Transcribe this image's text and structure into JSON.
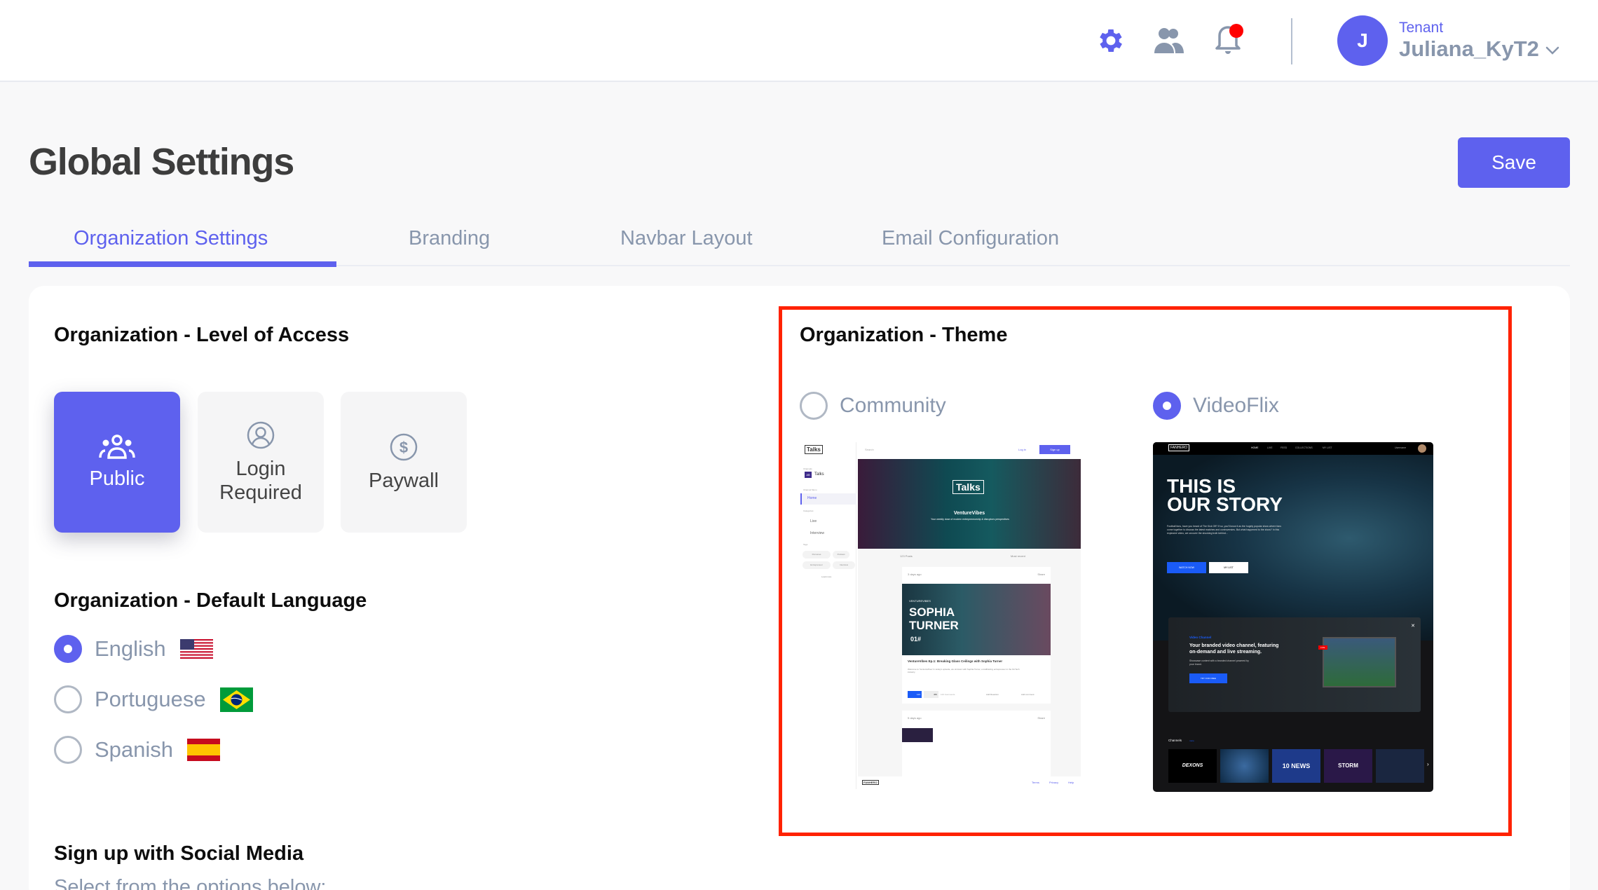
{
  "header": {
    "icons": [
      "gear-icon",
      "users-icon",
      "bell-icon"
    ],
    "notification_dot_color": "#ff0000",
    "avatar_initial": "J",
    "tenant_label": "Tenant",
    "tenant_name": "Juliana_KyT2"
  },
  "page": {
    "title": "Global Settings",
    "save_label": "Save"
  },
  "tabs": [
    {
      "label": "Organization Settings",
      "active": true
    },
    {
      "label": "Branding",
      "active": false
    },
    {
      "label": "Navbar Layout",
      "active": false
    },
    {
      "label": "Email Configuration",
      "active": false
    }
  ],
  "access": {
    "title": "Organization - Level of Access",
    "options": [
      {
        "label": "Public",
        "icon": "group-icon",
        "selected": true
      },
      {
        "label": "Login\nRequired",
        "icon": "user-circle-icon",
        "selected": false
      },
      {
        "label": "Paywall",
        "icon": "dollar-circle-icon",
        "selected": false
      }
    ]
  },
  "language": {
    "title": "Organization - Default Language",
    "options": [
      {
        "label": "English",
        "flag": "us-flag",
        "selected": true
      },
      {
        "label": "Portuguese",
        "flag": "brazil-flag",
        "selected": false
      },
      {
        "label": "Spanish",
        "flag": "spain-flag",
        "selected": false
      }
    ]
  },
  "social": {
    "title": "Sign up with Social Media",
    "subtitle": "Select from the options below:"
  },
  "theme": {
    "title": "Organization - Theme",
    "options": [
      {
        "label": "Community",
        "selected": false
      },
      {
        "label": "VideoFlix",
        "selected": true
      }
    ],
    "community_preview": {
      "logo": "Talks",
      "search_placeholder": "Search",
      "login": "Log in",
      "signup": "Sign up",
      "channels_label": "Channels",
      "channel_badge": "AB",
      "channel_name": "Talks",
      "channel_menu_label": "Channel Menu",
      "home": "Home",
      "categories_label": "Categories",
      "categories": [
        "Live",
        "Interview"
      ],
      "tags_label": "Tags",
      "tags": [
        "Personas",
        "Podcast",
        "Entrepreneur",
        "Interview"
      ],
      "load_more": "Load more",
      "banner_logo": "Talks",
      "banner_title": "VentureVibes",
      "banner_subtitle": "Your weekly dose of modern entrepreneurship & disruptors perspectives",
      "posts_count": "123 Posts",
      "sort": "Most recent",
      "post1_time": "3 days ago",
      "share": "Share",
      "post1_overlay_brand": "VENTUREVIBES",
      "post1_overlay_name1": "SOPHIA",
      "post1_overlay_name2": "TURNER",
      "post1_overlay_ep": "01#",
      "post1_title": "VentureVibes Ep.1: Breaking Glass Ceilings with Sophia Turner",
      "post1_desc": "Welcome to 'VentureVibes' In today's episode, we sit down with Sophia Turner, a trailblazing entrepreneur in the FinTech industry.",
      "post1_reaction1": "123",
      "post1_reaction2": "456",
      "post1_comments": "123 Comments",
      "add_reaction": "Add Reaction",
      "add_comment": "Add comment",
      "post2_time": "5 days ago",
      "footer_logo": "FANHERO",
      "footer_links": [
        "Terms",
        "Privacy",
        "Help"
      ]
    },
    "videoflix_preview": {
      "logo": "FANHERO",
      "nav": [
        "HOME",
        "LIVE",
        "FEED",
        "COLLECTIONS",
        "MY LIST"
      ],
      "user": "Username",
      "hero_title1": "THIS IS",
      "hero_title2": "OUR STORY",
      "hero_desc": "Football fans, have you heard of The Kick Off? If so, you'll know it as the hugely popular show where fans come together to discuss the latest matches and controversies. But what happened to the show? In this explosive video, we uncover the shocking truth behind...",
      "watch_now": "WATCH NOW",
      "my_list": "MY LIST",
      "promo_kicker": "Video Channel",
      "promo_title": "Your branded video channel, featuring on-demand and live streaming.",
      "promo_desc": "Showcase content with a branded channel powered by your brand.",
      "promo_cta": "TRY FOR FREE",
      "live_badge": "LIVE",
      "channels_label": "Channels",
      "channels_more": "more",
      "channels": [
        "DEXONS",
        "",
        "10 NEWS",
        "STORM",
        ""
      ]
    }
  }
}
